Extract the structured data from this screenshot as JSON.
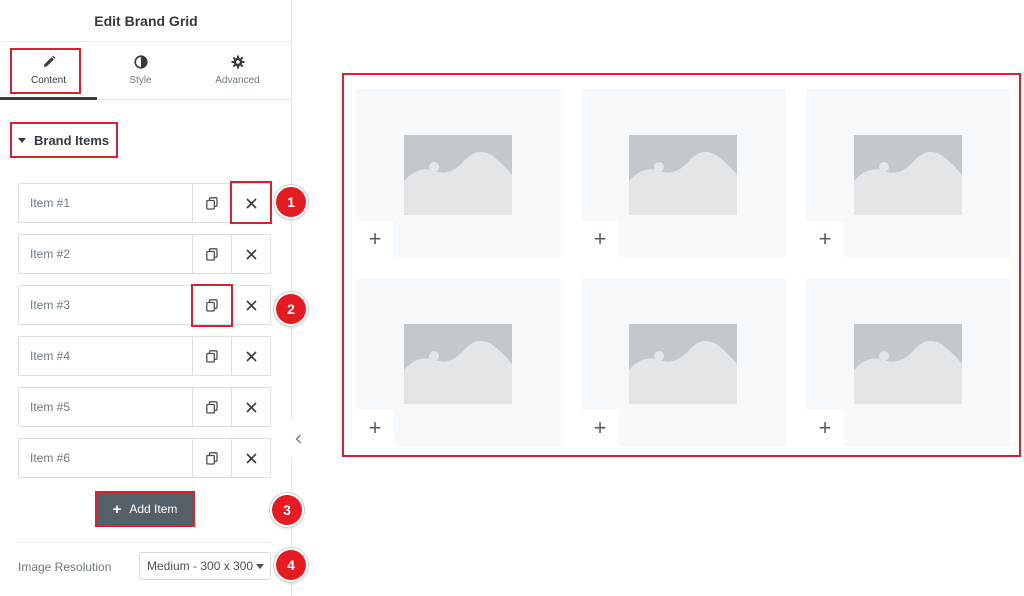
{
  "panel": {
    "title": "Edit Brand Grid",
    "tabs": [
      {
        "label": "Content",
        "icon": "pencil-icon",
        "active": true
      },
      {
        "label": "Style",
        "icon": "contrast-icon",
        "active": false
      },
      {
        "label": "Advanced",
        "icon": "gear-icon",
        "active": false
      }
    ],
    "section": {
      "label": "Brand Items",
      "expanded": true
    },
    "items": [
      {
        "label": "Item #1"
      },
      {
        "label": "Item #2"
      },
      {
        "label": "Item #3"
      },
      {
        "label": "Item #4"
      },
      {
        "label": "Item #5"
      },
      {
        "label": "Item #6"
      }
    ],
    "add_item_label": "Add Item",
    "image_resolution": {
      "label": "Image Resolution",
      "value": "Medium - 300 x 300"
    }
  },
  "annotations": [
    "1",
    "2",
    "3",
    "4"
  ],
  "preview": {
    "cells": 6,
    "columns": 3,
    "cell_icon": "image-placeholder-icon",
    "cell_add_icon": "plus-icon"
  },
  "colors": {
    "highlight": "#d9212f",
    "badge": "#e31b23",
    "button": "#556068",
    "cell_bg": "#f6f9fb",
    "placeholder": "#c3c8cd"
  }
}
